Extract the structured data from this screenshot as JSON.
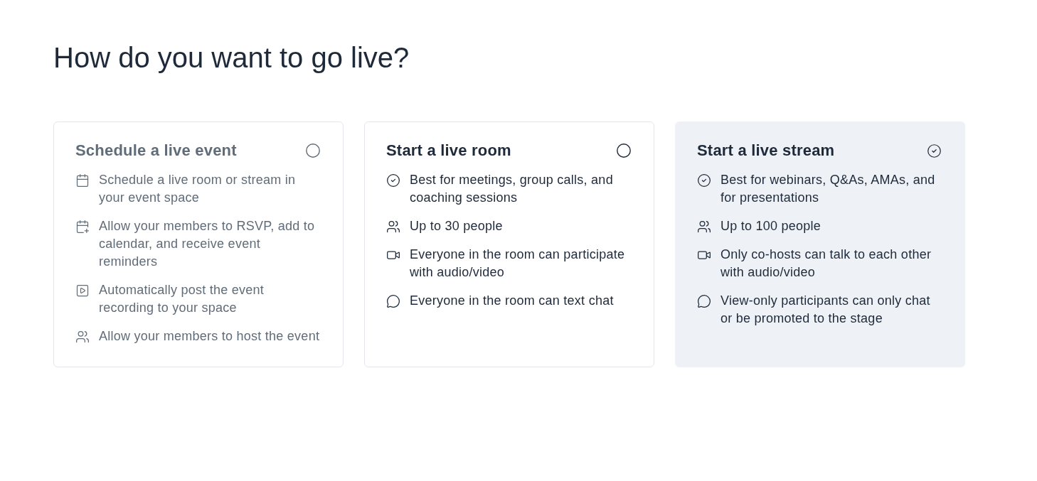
{
  "heading": "How do you want to go live?",
  "options": [
    {
      "title": "Schedule a live event",
      "selected": false,
      "disabled": true,
      "features": [
        {
          "kind": "calendar",
          "text": "Schedule a live room or stream in your event space"
        },
        {
          "kind": "calendar-add",
          "text": "Allow your members to RSVP, add to calendar, and receive event reminders"
        },
        {
          "kind": "recording",
          "text": "Automatically post the event recording to your space"
        },
        {
          "kind": "people",
          "text": "Allow your members to host the event"
        }
      ]
    },
    {
      "title": "Start a live room",
      "selected": false,
      "disabled": false,
      "features": [
        {
          "kind": "best-for",
          "text": "Best for meetings, group calls, and coaching sessions"
        },
        {
          "kind": "people",
          "text": "Up to 30 people"
        },
        {
          "kind": "audio-video",
          "text": "Everyone in the room can participate with audio/video"
        },
        {
          "kind": "chat",
          "text": "Everyone in the room can text chat"
        }
      ]
    },
    {
      "title": "Start a live stream",
      "selected": true,
      "disabled": false,
      "features": [
        {
          "kind": "best-for",
          "text": "Best for webinars, Q&As, AMAs, and for presentations"
        },
        {
          "kind": "people",
          "text": "Up to 100 people"
        },
        {
          "kind": "audio-video",
          "text": "Only co-hosts can talk to each other with audio/video"
        },
        {
          "kind": "chat",
          "text": "View-only participants can only chat or be promoted to the stage"
        }
      ]
    }
  ]
}
